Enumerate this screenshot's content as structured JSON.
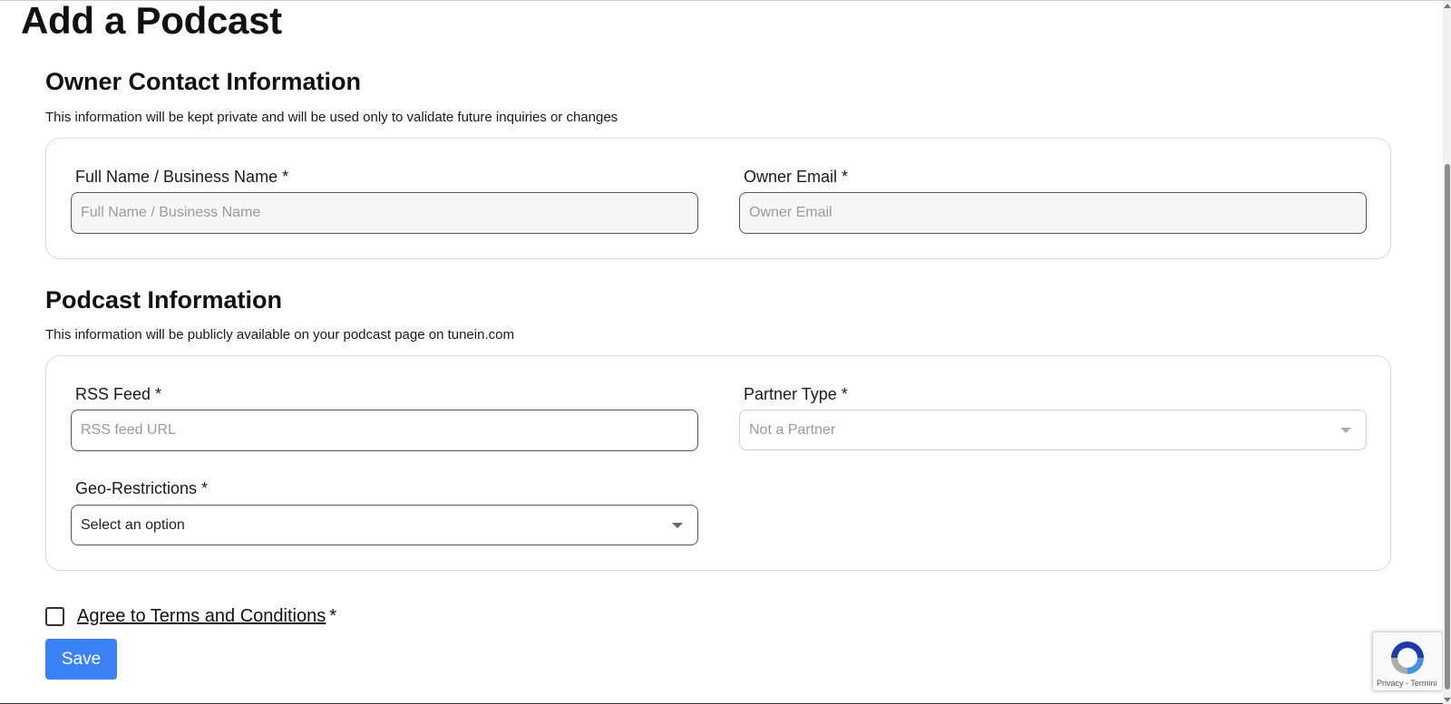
{
  "page": {
    "title": "Add a Podcast"
  },
  "owner_section": {
    "title": "Owner Contact Information",
    "subtitle": "This information will be kept private and will be used only to validate future inquiries or changes",
    "full_name": {
      "label": "Full Name / Business Name *",
      "placeholder": "Full Name / Business Name",
      "value": ""
    },
    "owner_email": {
      "label": "Owner Email *",
      "placeholder": "Owner Email",
      "value": ""
    }
  },
  "podcast_section": {
    "title": "Podcast Information",
    "subtitle": "This information will be publicly available on your podcast page on tunein.com",
    "rss_feed": {
      "label": "RSS Feed *",
      "placeholder": "RSS feed URL",
      "value": ""
    },
    "partner_type": {
      "label": "Partner Type *",
      "selected": "Not a Partner",
      "disabled": true
    },
    "geo_restrictions": {
      "label": "Geo-Restrictions *",
      "selected": "Select an option"
    }
  },
  "terms": {
    "link_text": "Agree to Terms and Conditions",
    "required_mark": "*",
    "checked": false
  },
  "actions": {
    "save_label": "Save",
    "save_color": "#3b82f6"
  },
  "recaptcha": {
    "links": "Privacy - Termini",
    "icon": "recaptcha-icon"
  }
}
